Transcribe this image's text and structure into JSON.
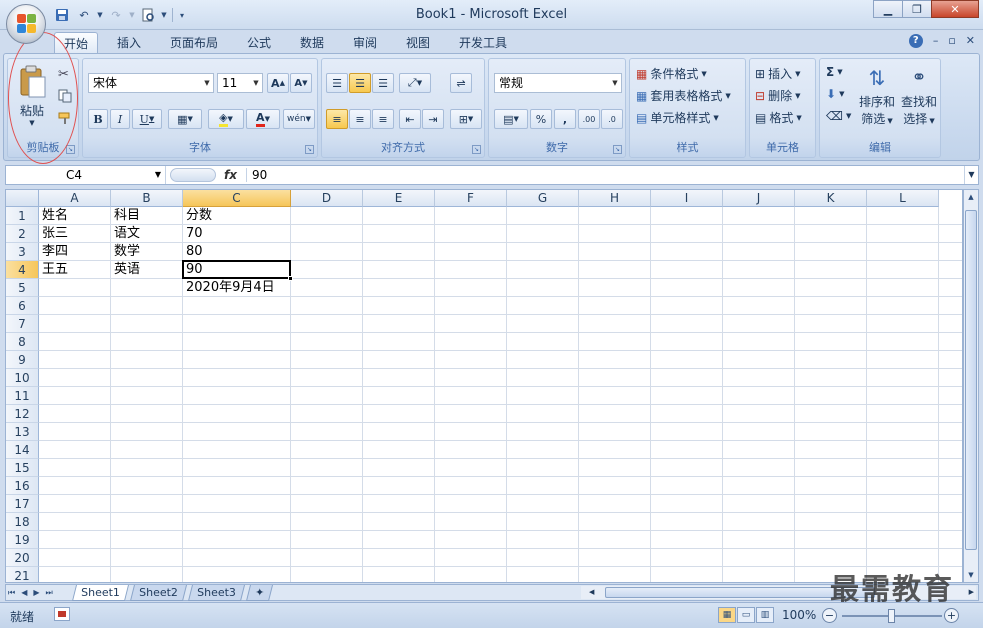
{
  "window": {
    "title": "Book1 - Microsoft Excel"
  },
  "tabs": [
    "开始",
    "插入",
    "页面布局",
    "公式",
    "数据",
    "审阅",
    "视图",
    "开发工具"
  ],
  "ribbon": {
    "clipboard": {
      "label": "剪贴板",
      "paste": "粘贴"
    },
    "font": {
      "label": "字体",
      "name": "宋体",
      "size": "11"
    },
    "alignment": {
      "label": "对齐方式"
    },
    "number": {
      "label": "数字",
      "format": "常规"
    },
    "styles": {
      "label": "样式",
      "conditional": "条件格式",
      "table": "套用表格格式",
      "cell_styles": "单元格样式"
    },
    "cells": {
      "label": "单元格",
      "insert": "插入",
      "delete": "删除",
      "format": "格式"
    },
    "editing": {
      "label": "编辑",
      "sort_1": "排序和",
      "sort_2": "筛选",
      "find_1": "查找和",
      "find_2": "选择"
    }
  },
  "formula_bar": {
    "name_box": "C4",
    "fx": "fx",
    "value": "90"
  },
  "columns": [
    "A",
    "B",
    "C",
    "D",
    "E",
    "F",
    "G",
    "H",
    "I",
    "J",
    "K",
    "L"
  ],
  "rows": [
    "1",
    "2",
    "3",
    "4",
    "5",
    "6",
    "7",
    "8",
    "9",
    "10",
    "11",
    "12",
    "13",
    "14",
    "15",
    "16",
    "17",
    "18",
    "19",
    "20",
    "21"
  ],
  "cells": {
    "A1": "姓名",
    "B1": "科目",
    "C1": "分数",
    "A2": "张三",
    "B2": "语文",
    "C2": "70",
    "A3": "李四",
    "B3": "数学",
    "C3": "80",
    "A4": "王五",
    "B4": "英语",
    "C4": "90",
    "C5": "2020年9月4日"
  },
  "sheets": [
    "Sheet1",
    "Sheet2",
    "Sheet3"
  ],
  "status": {
    "ready": "就绪",
    "zoom": "100%"
  },
  "watermark": "最需教育",
  "colors": {
    "selected_header": "#f6c65a",
    "accent": "#1e395b",
    "annotation": "#e05050"
  }
}
